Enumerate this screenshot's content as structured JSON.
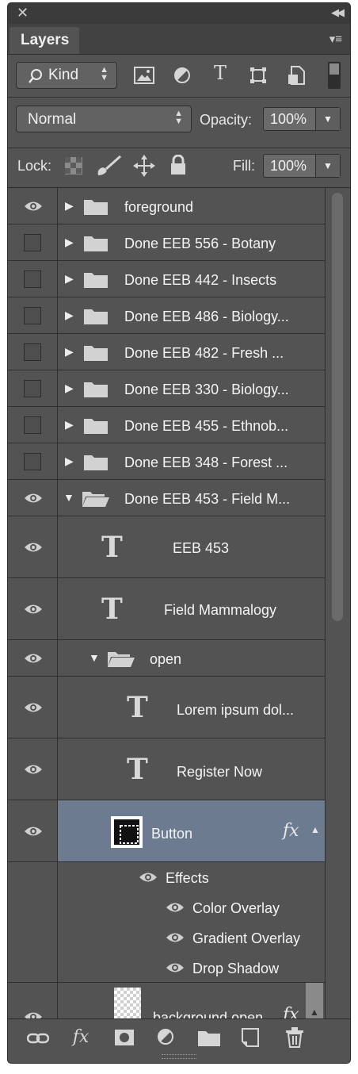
{
  "panel": {
    "tab_label": "Layers",
    "close_glyph": "✕",
    "collapse_glyph": "◀◀",
    "menu_glyph": "▾≡"
  },
  "filter": {
    "kind_label": "Kind",
    "icons": [
      "image-filter-icon",
      "adjustment-filter-icon",
      "type-filter-icon",
      "shape-filter-icon",
      "smart-object-filter-icon",
      "filter-toggle-icon"
    ]
  },
  "blend": {
    "mode": "Normal",
    "opacity_label": "Opacity:",
    "opacity_value": "100%"
  },
  "lock": {
    "label": "Lock:",
    "fill_label": "Fill:",
    "fill_value": "100%"
  },
  "layers": [
    {
      "name": "foreground",
      "type": "group",
      "visible": true,
      "expanded": false
    },
    {
      "name": "Done EEB 556 - Botany",
      "type": "group",
      "visible": false,
      "expanded": false
    },
    {
      "name": "Done EEB 442 - Insects",
      "type": "group",
      "visible": false,
      "expanded": false
    },
    {
      "name": "Done EEB 486 - Biology...",
      "type": "group",
      "visible": false,
      "expanded": false
    },
    {
      "name": "Done EEB 482 - Fresh ...",
      "type": "group",
      "visible": false,
      "expanded": false
    },
    {
      "name": "Done EEB 330 - Biology...",
      "type": "group",
      "visible": false,
      "expanded": false
    },
    {
      "name": "Done EEB 455 - Ethnob...",
      "type": "group",
      "visible": false,
      "expanded": false
    },
    {
      "name": "Done EEB 348 - Forest ...",
      "type": "group",
      "visible": false,
      "expanded": false
    },
    {
      "name": "Done EEB 453 - Field M...",
      "type": "group",
      "visible": true,
      "expanded": true
    },
    {
      "name": "EEB 453",
      "type": "text",
      "visible": true
    },
    {
      "name": "Field Mammalogy",
      "type": "text",
      "visible": true
    },
    {
      "name": "open",
      "type": "group",
      "visible": true,
      "expanded": true
    },
    {
      "name": "Lorem ipsum dol...",
      "type": "text",
      "visible": true
    },
    {
      "name": "Register Now",
      "type": "text",
      "visible": true
    },
    {
      "name": "Button",
      "type": "shape",
      "visible": true,
      "selected": true,
      "fx": "fx"
    },
    {
      "name": "background open",
      "type": "raster",
      "visible": true,
      "fx": "fx"
    }
  ],
  "effects": {
    "label": "Effects",
    "items": [
      "Color Overlay",
      "Gradient Overlay",
      "Drop Shadow"
    ]
  },
  "text_icon_glyph": "T",
  "footer": {
    "icons": [
      "link-layers-icon",
      "fx-icon",
      "add-mask-icon",
      "new-adjustment-icon",
      "new-group-icon",
      "new-layer-icon",
      "delete-icon"
    ],
    "fx_glyph": "fx"
  }
}
